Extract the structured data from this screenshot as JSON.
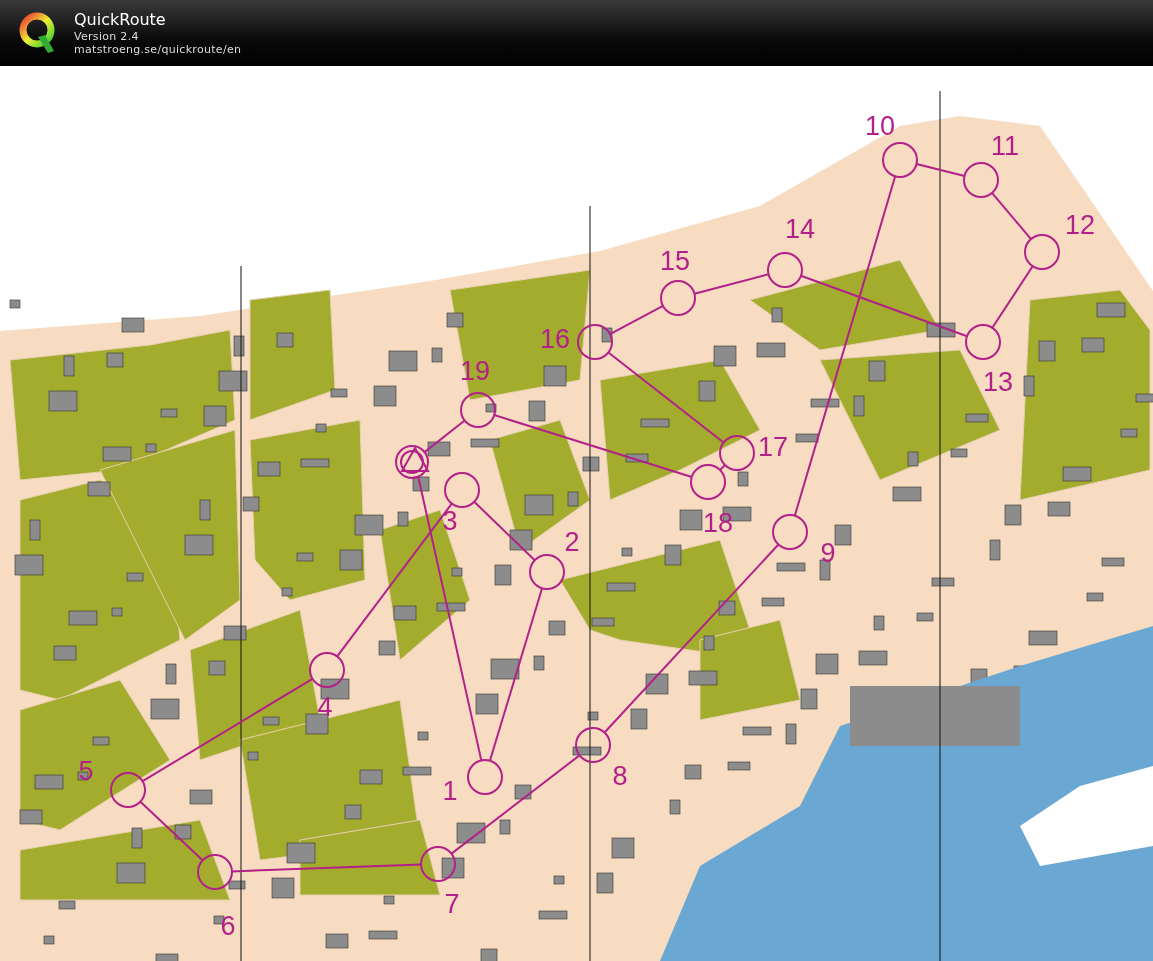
{
  "app": {
    "name": "QuickRoute",
    "version": "Version 2.4",
    "url": "matstroeng.se/quickroute/en"
  },
  "course": {
    "controls": [
      {
        "number": "1"
      },
      {
        "number": "2"
      },
      {
        "number": "3"
      },
      {
        "number": "4"
      },
      {
        "number": "5"
      },
      {
        "number": "6"
      },
      {
        "number": "7"
      },
      {
        "number": "8"
      },
      {
        "number": "9"
      },
      {
        "number": "10"
      },
      {
        "number": "11"
      },
      {
        "number": "12"
      },
      {
        "number": "13"
      },
      {
        "number": "14"
      },
      {
        "number": "15"
      },
      {
        "number": "16"
      },
      {
        "number": "17"
      },
      {
        "number": "18"
      },
      {
        "number": "19"
      }
    ]
  }
}
